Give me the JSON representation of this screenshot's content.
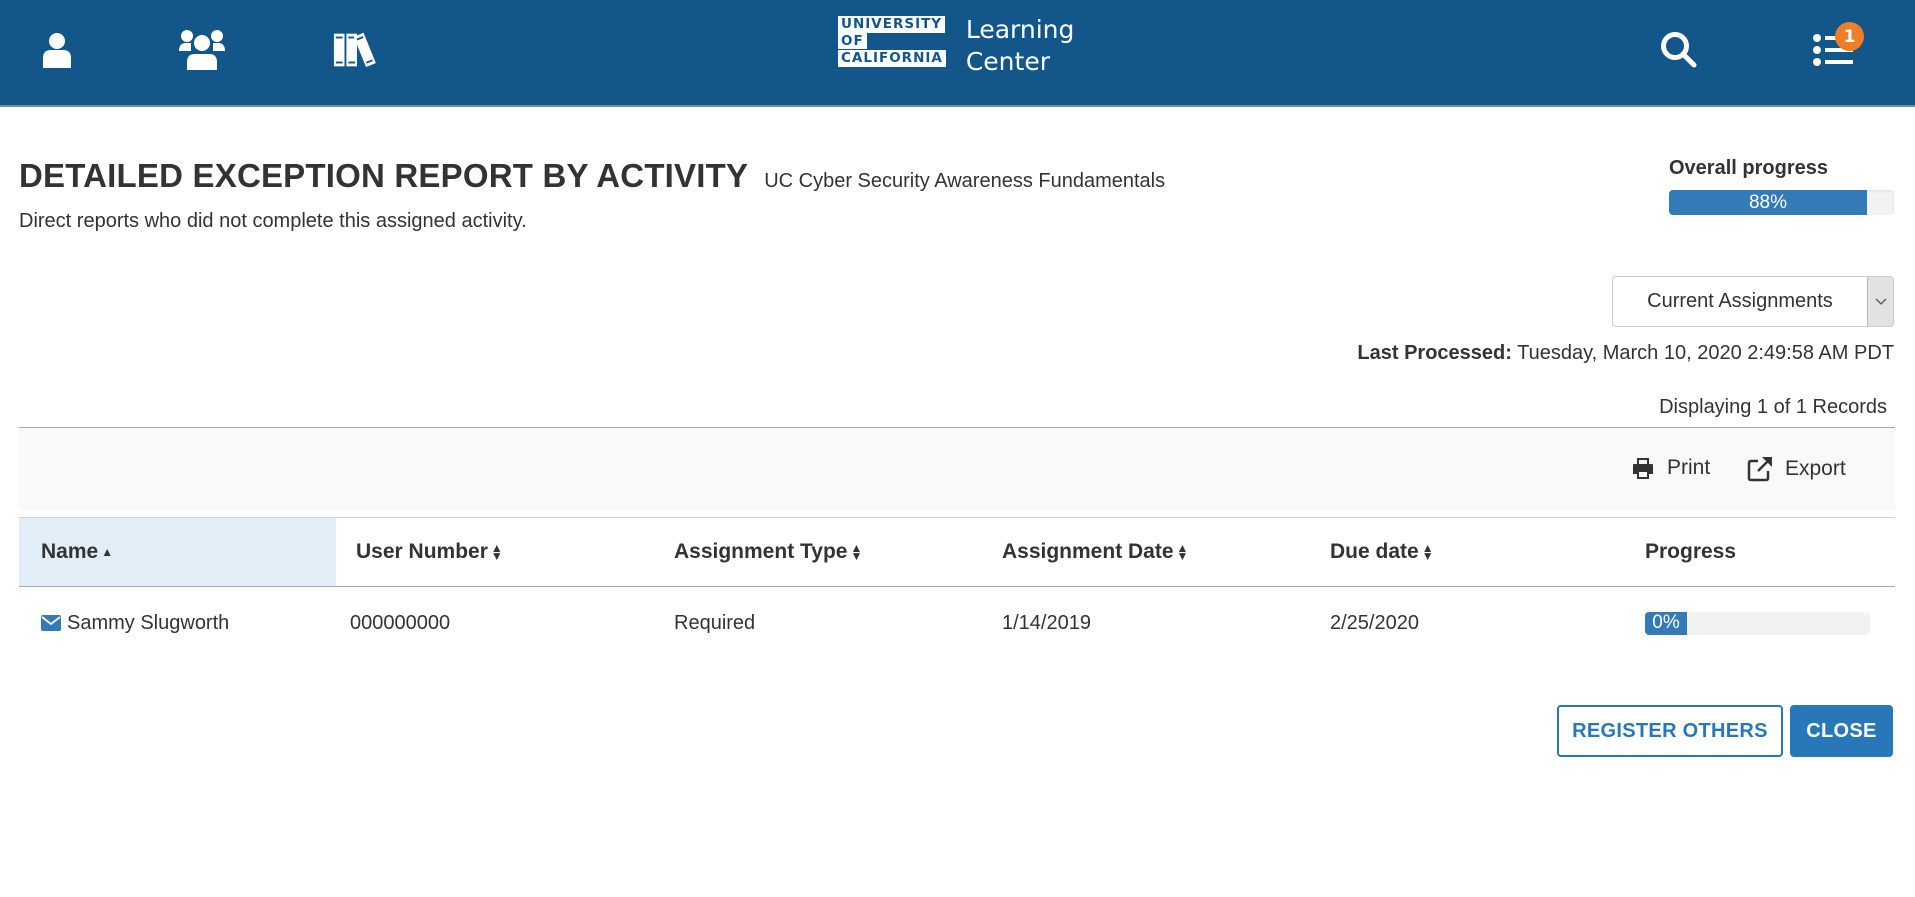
{
  "header": {
    "nav_icons": [
      {
        "icon": "user-icon",
        "label": "Me"
      },
      {
        "icon": "team-icon",
        "label": "My Team"
      },
      {
        "icon": "library-icon",
        "label": "Library"
      }
    ],
    "logo": {
      "line1": "UNIVERSITY",
      "line2": "OF",
      "line3": "CALIFORNIA",
      "app_line1": "Learning",
      "app_line2": "Center"
    },
    "search_icon": "search-icon",
    "tasks_icon": "task-list-icon",
    "notification_count": "1",
    "colors": {
      "bar": "#13568a",
      "badge": "#f07e26"
    }
  },
  "report": {
    "title": "DETAILED EXCEPTION REPORT BY ACTIVITY",
    "activity": "UC Cyber Security Awareness Fundamentals",
    "subtitle": "Direct reports who did not complete this assigned activity.",
    "overall_progress_label": "Overall progress",
    "overall_progress_value": 88,
    "overall_progress_text": "88%",
    "filter_selected": "Current Assignments",
    "last_processed_label": "Last Processed:",
    "last_processed_value": "Tuesday, March 10, 2020 2:49:58 AM PDT",
    "records_text": "Displaying 1 of 1 Records"
  },
  "toolbar": {
    "print_label": "Print",
    "export_label": "Export"
  },
  "table": {
    "columns": [
      {
        "label": "Name",
        "sort": "asc"
      },
      {
        "label": "User Number",
        "sort": "both"
      },
      {
        "label": "Assignment Type",
        "sort": "both"
      },
      {
        "label": "Assignment Date",
        "sort": "both"
      },
      {
        "label": "Due date",
        "sort": "both"
      },
      {
        "label": "Progress",
        "sort": "none"
      }
    ],
    "rows": [
      {
        "name": "Sammy Slugworth",
        "user_number": "000000000",
        "assignment_type": "Required",
        "assignment_date": "1/14/2019",
        "due_date": "2/25/2020",
        "progress_value": 0,
        "progress_text": "0%"
      }
    ]
  },
  "actions": {
    "register_others": "REGISTER OTHERS",
    "close": "CLOSE"
  },
  "colors": {
    "accent": "#2878b9",
    "progress": "#337ab7",
    "sorted_header": "#e2eef7"
  }
}
